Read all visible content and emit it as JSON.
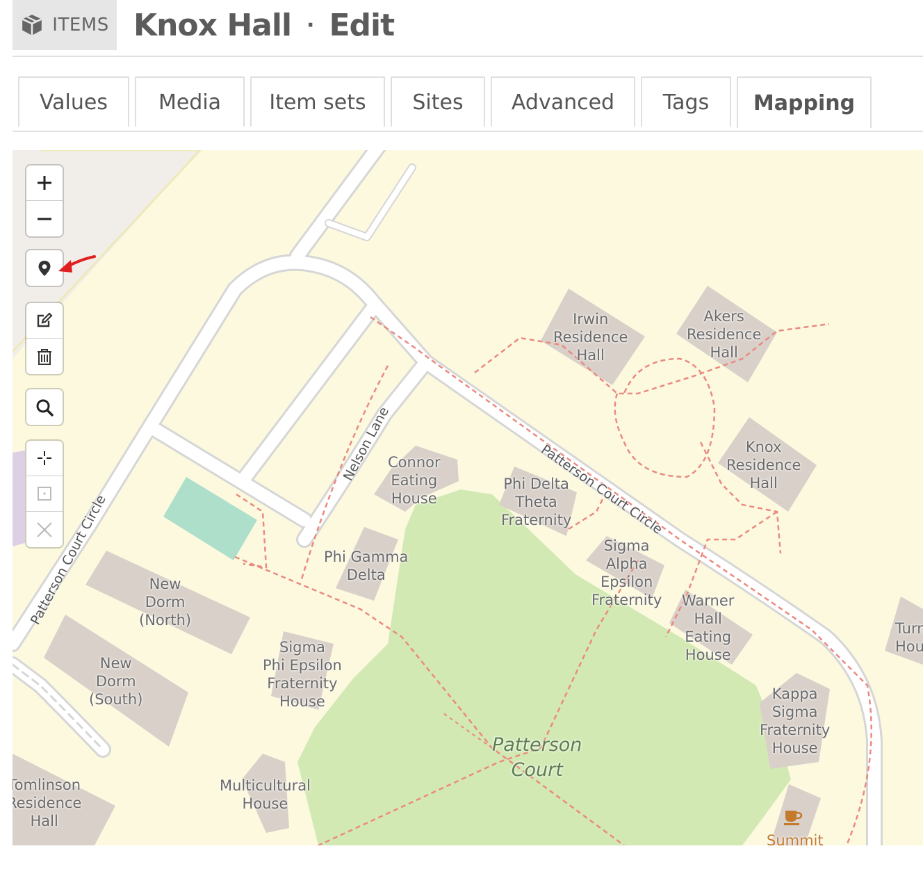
{
  "header": {
    "resource_label": "ITEMS",
    "resource_icon": "cube-icon",
    "title": "Knox Hall",
    "separator": "·",
    "action": "Edit"
  },
  "tabs": [
    {
      "label": "Values",
      "active": false
    },
    {
      "label": "Media",
      "active": false
    },
    {
      "label": "Item sets",
      "active": false
    },
    {
      "label": "Sites",
      "active": false
    },
    {
      "label": "Advanced",
      "active": false
    },
    {
      "label": "Tags",
      "active": false
    },
    {
      "label": "Mapping",
      "active": true
    }
  ],
  "map": {
    "controls": {
      "zoom_in": "+",
      "zoom_out": "−",
      "marker_icon": "map-marker-icon",
      "edit_icon": "edit-layers-icon",
      "delete_icon": "trash-icon",
      "search_icon": "search-icon",
      "crosshair_icon": "crosshair-icon",
      "default_view_icon": "default-view-icon",
      "clear_icon": "close-icon"
    },
    "annotation_arrow_color": "#e02020",
    "labels": {
      "irwin": "Irwin\nResidence\nHall",
      "akers": "Akers\nResidence\nHall",
      "knox": "Knox\nResidence\nHall",
      "connor": "Connor\nEating\nHouse",
      "phi_delta": "Phi Delta\nTheta\nFraternity",
      "sigma_alpha": "Sigma\nAlpha\nEpsilon\nFraternity",
      "warner": "Warner\nHall\nEating\nHouse",
      "phi_gamma": "Phi Gamma\nDelta",
      "new_dorm_north": "New\nDorm\n(North)",
      "new_dorm_south": "New\nDorm\n(South)",
      "sigma_phi": "Sigma\nPhi Epsilon\nFraternity\nHouse",
      "kappa": "Kappa\nSigma\nFraternity\nHouse",
      "multicultural": "Multicultural\nHouse",
      "tomlinson": "Tomlinson\nResidence\nHall",
      "patterson_court": "Patterson\nCourt",
      "summit": "Summit",
      "turner": "Turn\nHou"
    },
    "streets": {
      "nelson_lane": "Nelson Lane",
      "patterson_circle_top": "Patterson Court Circle",
      "patterson_circle_left": "Patterson Court Circle"
    },
    "colors": {
      "land": "#fcf9df",
      "park": "#d3e9b4",
      "building": "#d9d0c9",
      "road": "#ffffff",
      "road_casing": "#d6d6d6",
      "footpath": "#ea8a80",
      "pitch": "#aedfca"
    }
  }
}
